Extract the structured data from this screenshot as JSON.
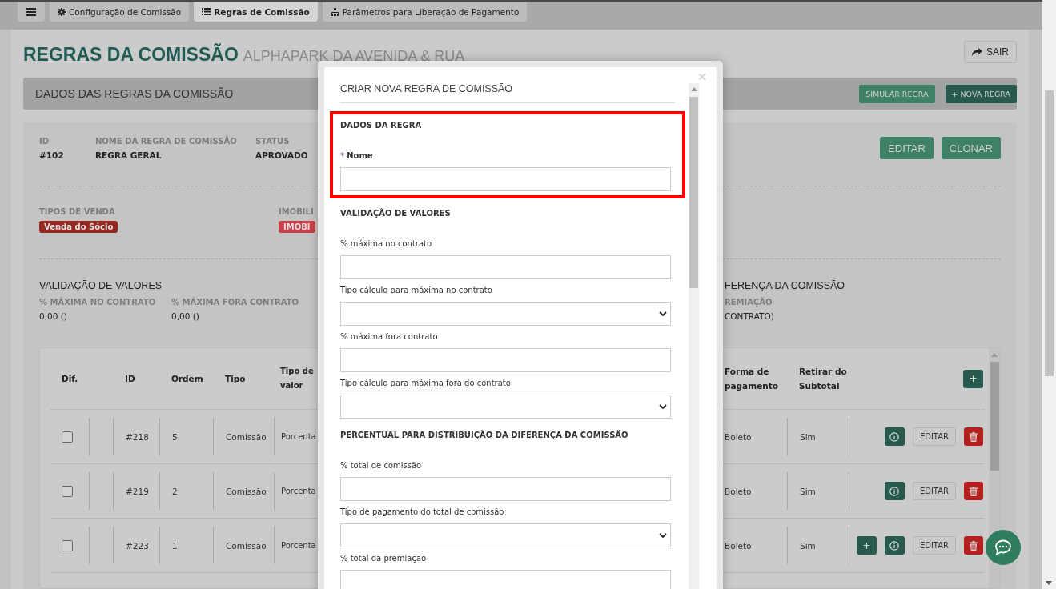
{
  "tabs": [
    {
      "label": "Configuração de Comissão",
      "kind": "gear",
      "selected": false
    },
    {
      "label": "Regras de Comissão",
      "kind": "list",
      "selected": true
    },
    {
      "label": "Parâmetros para Liberação de Pagamento",
      "kind": "sitemap",
      "selected": false
    }
  ],
  "page": {
    "title": "REGRAS DA COMISSÃO",
    "subtitle": "ALPHAPARK DA AVENIDA & RUA",
    "exit_button": "SAIR"
  },
  "section": {
    "title": "DADOS DAS REGRAS DA COMISSÃO",
    "buttons": [
      {
        "label": "SIMULAR REGRA",
        "kind": "secondary"
      },
      {
        "label": "+ NOVA REGRA",
        "kind": "primary"
      }
    ]
  },
  "rule": {
    "fields": [
      {
        "label": "ID",
        "value": "#102"
      },
      {
        "label": "NOME DA REGRA DE COMISSÃO",
        "value": "REGRA GERAL"
      },
      {
        "label": "STATUS",
        "value": "APROVADO"
      }
    ],
    "actions": [
      "EDITAR",
      "CLONAR"
    ],
    "tags": [
      {
        "label": "TIPOS DE VENDA",
        "badge": "Venda do Sócio",
        "color": "#962820"
      },
      {
        "label": "IMOBILI",
        "badge": "IMOBI",
        "color": "#c9404b"
      }
    ],
    "validation": {
      "title": "VALIDAÇÃO DE VALORES",
      "items": [
        {
          "label": "% MÁXIMA NO CONTRATO",
          "value": "0,00 ()"
        },
        {
          "label": "% MÁXIMA FORA CONTRATO",
          "value": "0,00 ()"
        }
      ]
    },
    "distribution": {
      "title": "FERENÇA DA COMISSÃO",
      "label": "REMIAÇÃO",
      "value": "CONTRATO)"
    }
  },
  "table": {
    "header": {
      "dif": "Dif.",
      "id": "ID",
      "ordem": "Ordem",
      "tipo": "Tipo",
      "tipo_valor": "Tipo de valor",
      "forma_pagamento": "Forma de pagamento",
      "retirar_subtotal": "Retirar do Subtotal",
      "add_button": "+"
    },
    "rows": [
      {
        "checked": false,
        "id": "#218",
        "ordem": "5",
        "tipo": "Comissão",
        "tipo_valor": "Porcenta",
        "forma_pagamento": "Boleto",
        "retirar_subtotal": "Sim",
        "actions": [
          {
            "kind": "info"
          },
          {
            "kind": "edit",
            "label": "EDITAR"
          },
          {
            "kind": "delete"
          }
        ]
      },
      {
        "checked": false,
        "id": "#219",
        "ordem": "2",
        "tipo": "Comissão",
        "tipo_valor": "Porcenta",
        "forma_pagamento": "Boleto",
        "retirar_subtotal": "Sim",
        "actions": [
          {
            "kind": "info"
          },
          {
            "kind": "edit",
            "label": "EDITAR"
          },
          {
            "kind": "delete"
          }
        ]
      },
      {
        "checked": false,
        "id": "#223",
        "ordem": "1",
        "tipo": "Comissão",
        "tipo_valor": "Porcenta",
        "forma_pagamento": "Boleto",
        "retirar_subtotal": "Sim",
        "actions": [
          {
            "kind": "add",
            "label": "+"
          },
          {
            "kind": "info"
          },
          {
            "kind": "edit",
            "label": "EDITAR"
          },
          {
            "kind": "delete"
          }
        ]
      }
    ]
  },
  "modal": {
    "title": "CRIAR NOVA REGRA DE COMISSÃO",
    "sections": [
      {
        "title": "DADOS DA REGRA",
        "highlighted": true,
        "fields": [
          {
            "kind": "input",
            "label": "Nome",
            "required_mark": "*"
          }
        ]
      },
      {
        "title": "VALIDAÇÃO DE VALORES",
        "highlighted": false,
        "fields": [
          {
            "kind": "input",
            "label": "% máxima no contrato"
          },
          {
            "kind": "select",
            "label": "Tipo cálculo para máxima no contrato"
          },
          {
            "kind": "input",
            "label": "% máxima fora contrato"
          },
          {
            "kind": "select",
            "label": "Tipo cálculo para máxima fora do contrato"
          }
        ]
      },
      {
        "title": "PERCENTUAL PARA DISTRIBUIÇÃO DA DIFERENÇA DA COMISSÃO",
        "highlighted": false,
        "fields": [
          {
            "kind": "input",
            "label": "% total de comissão"
          },
          {
            "kind": "select",
            "label": "Tipo de pagamento do total de comissão"
          },
          {
            "kind": "input",
            "label": "% total da premiação"
          }
        ]
      }
    ]
  }
}
